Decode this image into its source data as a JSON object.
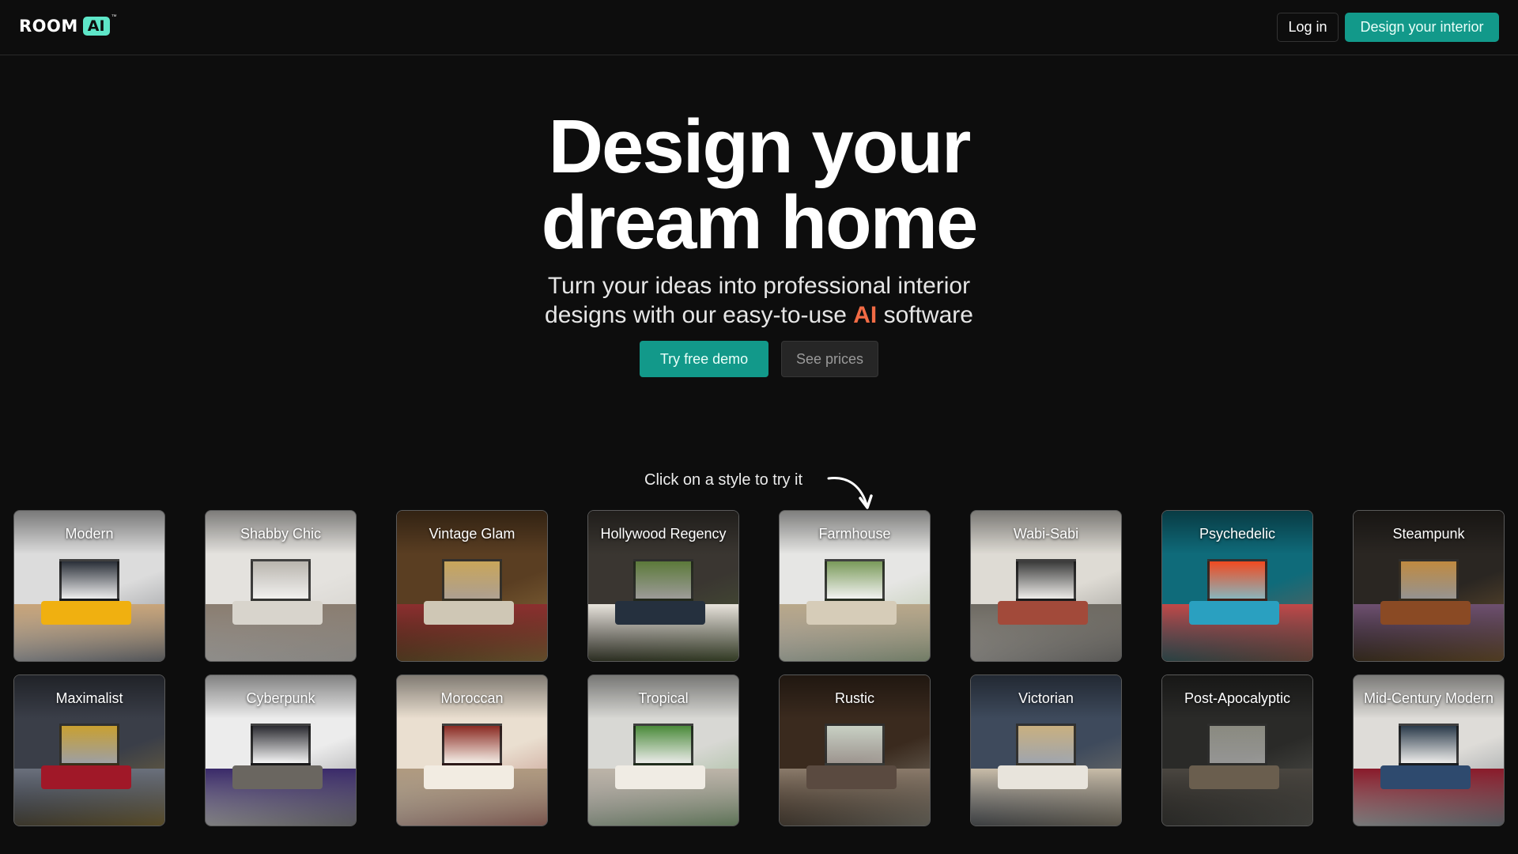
{
  "header": {
    "logo_word": "ROOM",
    "logo_badge": "AI",
    "logo_tm": "™",
    "login_label": "Log in",
    "cta_label": "Design your interior"
  },
  "hero": {
    "title_line1": "Design your",
    "title_line2": "dream home",
    "subtitle_line1": "Turn your ideas into professional interior",
    "subtitle_line2_before": "designs with our easy-to-use",
    "subtitle_highlight": "AI",
    "subtitle_line2_after": "software",
    "demo_label": "Try free demo",
    "prices_label": "See prices"
  },
  "styles_section": {
    "hint": "Click on a style to try it",
    "styles": [
      {
        "label": "Modern",
        "wall": "#dcdcdc",
        "accent": "#2a2f38",
        "floor": "#c9a57a",
        "sofa": "#f0b010"
      },
      {
        "label": "Shabby Chic",
        "wall": "#e4e2de",
        "accent": "#b9b5ae",
        "floor": "#8a7d70",
        "sofa": "#d8d4cc"
      },
      {
        "label": "Vintage Glam",
        "wall": "#5a3e22",
        "accent": "#c9a65a",
        "floor": "#8c2f2f",
        "sofa": "#cfc7b5"
      },
      {
        "label": "Hollywood Regency",
        "wall": "#3a3631",
        "accent": "#5c7a3a",
        "floor": "#e8e4dc",
        "sofa": "#25303e"
      },
      {
        "label": "Farmhouse",
        "wall": "#e6e6e4",
        "accent": "#7a9a5a",
        "floor": "#b9a88a",
        "sofa": "#d6ccb8"
      },
      {
        "label": "Wabi-Sabi",
        "wall": "#dedbd4",
        "accent": "#3a3a3a",
        "floor": "#6e6a62",
        "sofa": "#a24a3a"
      },
      {
        "label": "Psychedelic",
        "wall": "#0f6b7a",
        "accent": "#f04a20",
        "floor": "#c24848",
        "sofa": "#2aa0c0"
      },
      {
        "label": "Steampunk",
        "wall": "#2a2622",
        "accent": "#c08a40",
        "floor": "#6e5070",
        "sofa": "#8a4a24"
      },
      {
        "label": "Maximalist",
        "wall": "#3a3e48",
        "accent": "#c9a030",
        "floor": "#6a707c",
        "sofa": "#a01828"
      },
      {
        "label": "Cyberpunk",
        "wall": "#ececec",
        "accent": "#2a2a30",
        "floor": "#3a2a6a",
        "sofa": "#6a6660"
      },
      {
        "label": "Moroccan",
        "wall": "#eadfd0",
        "accent": "#8a2a22",
        "floor": "#b09a80",
        "sofa": "#f2ece2"
      },
      {
        "label": "Tropical",
        "wall": "#d8d8d4",
        "accent": "#4a8a3a",
        "floor": "#bcb4a8",
        "sofa": "#f0ece4"
      },
      {
        "label": "Rustic",
        "wall": "#3a2a1e",
        "accent": "#c8d0c4",
        "floor": "#8a7a6a",
        "sofa": "#5a4a40"
      },
      {
        "label": "Victorian",
        "wall": "#3e4a5c",
        "accent": "#c9b080",
        "floor": "#c8bca8",
        "sofa": "#e8e4dc"
      },
      {
        "label": "Post-Apocalyptic",
        "wall": "#2a2a28",
        "accent": "#8a8a80",
        "floor": "#4a4640",
        "sofa": "#6a5e4e"
      },
      {
        "label": "Mid-Century Modern",
        "wall": "#dedcd8",
        "accent": "#2a3a4a",
        "floor": "#8a1a2a",
        "sofa": "#2e4a6e"
      }
    ]
  }
}
